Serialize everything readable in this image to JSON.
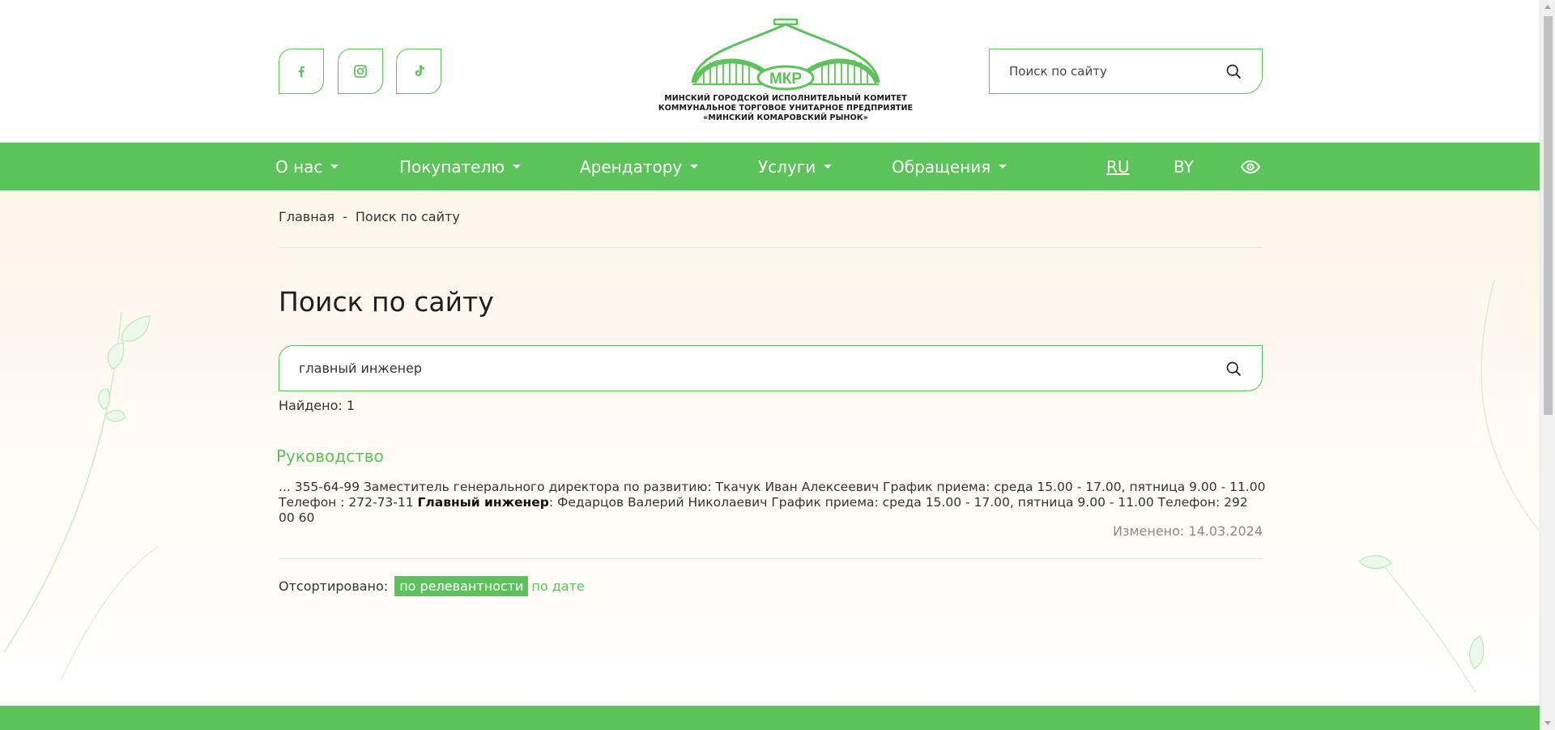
{
  "header": {
    "social": [
      {
        "name": "facebook-icon"
      },
      {
        "name": "instagram-icon"
      },
      {
        "name": "tiktok-icon"
      }
    ],
    "logo": {
      "abbr": "МКР",
      "line1": "МИНСКИЙ ГОРОДСКОЙ ИСПОЛНИТЕЛЬНЫЙ КОМИТЕТ",
      "line2": "КОММУНАЛЬНОЕ ТОРГОВОЕ УНИТАРНОЕ ПРЕДПРИЯТИЕ",
      "line3": "«МИНСКИЙ КОМАРОВСКИЙ РЫНОК»"
    },
    "search": {
      "placeholder": "Поиск по сайту"
    }
  },
  "nav": {
    "items": [
      {
        "label": "О нас"
      },
      {
        "label": "Покупателю"
      },
      {
        "label": "Арендатору"
      },
      {
        "label": "Услуги"
      },
      {
        "label": "Обращения"
      }
    ],
    "lang_ru": "RU",
    "lang_by": "BY",
    "accessibility_icon": "eye-icon"
  },
  "breadcrumb": {
    "home": "Главная",
    "separator": "-",
    "current": "Поиск по сайту"
  },
  "page_title": "Поиск по сайту",
  "search": {
    "value": "главный инженер"
  },
  "found_text": "Найдено: 1",
  "result": {
    "title": "Руководство",
    "snippet_before": "... 355-64-99 Заместитель генерального директора по развитию: Ткачук Иван Алексеевич График приема: среда 15.00 - 17.00, пятница 9.00 - 11.00 Телефон : 272-73-11 ",
    "snippet_highlight": "Главный инженер",
    "snippet_after": ": Федарцов Валерий Николаевич График приема: среда 15.00 - 17.00, пятница 9.00 - 11.00 Телефон: 292 00 60",
    "modified": "Изменено: 14.03.2024"
  },
  "sort": {
    "label": "Отсортировано:",
    "active": "по релевантности",
    "other": "по дате"
  },
  "colors": {
    "accent": "#5cc25a",
    "bg_cream": "#fdf5e9"
  }
}
